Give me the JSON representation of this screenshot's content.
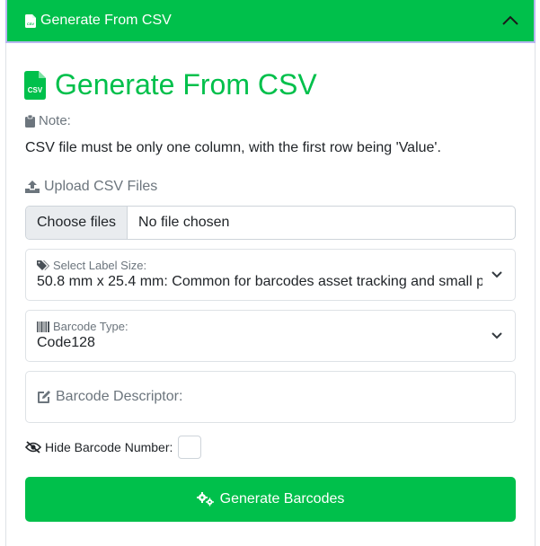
{
  "accordion": {
    "header_title": "Generate From CSV",
    "header_icon": "file-csv-icon",
    "toggle_icon": "chevron-up-icon"
  },
  "main": {
    "title": "Generate From CSV",
    "title_icon": "file-csv-icon",
    "note_label": "Note:",
    "note_text": "CSV file must be only one column, with the first row being 'Value'.",
    "upload_label": "Upload CSV Files",
    "file_input": {
      "button_label": "Choose files",
      "status": "No file chosen"
    },
    "label_size": {
      "label": "Select Label Size:",
      "selected": "50.8 mm x 25.4 mm: Common for barcodes asset tracking and small p"
    },
    "barcode_type": {
      "label": "Barcode Type:",
      "selected": "Code128"
    },
    "descriptor": {
      "placeholder": "Barcode Descriptor:"
    },
    "hide_number": {
      "label": "Hide Barcode Number:",
      "checked": false
    },
    "generate_button": "Generate Barcodes"
  },
  "colors": {
    "accent": "#00c04b",
    "muted": "#6c757d",
    "header_border": "#b9b7f0"
  }
}
